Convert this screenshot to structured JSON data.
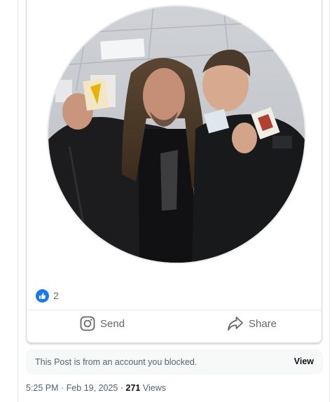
{
  "post": {
    "photo_alt": "",
    "reactions": {
      "icon": "like-icon",
      "count": "2",
      "color": "#1877f2"
    },
    "actions": [
      {
        "label": "Send",
        "icon": "instagram-icon"
      },
      {
        "label": "Share",
        "icon": "share-icon"
      }
    ]
  },
  "notice": {
    "text": "This Post is from an account you blocked.",
    "action_label": "View"
  },
  "meta": {
    "time": "5:25 PM",
    "date": "Feb 19, 2025",
    "separator": "·",
    "views_count": "271",
    "views_label": "Views"
  }
}
